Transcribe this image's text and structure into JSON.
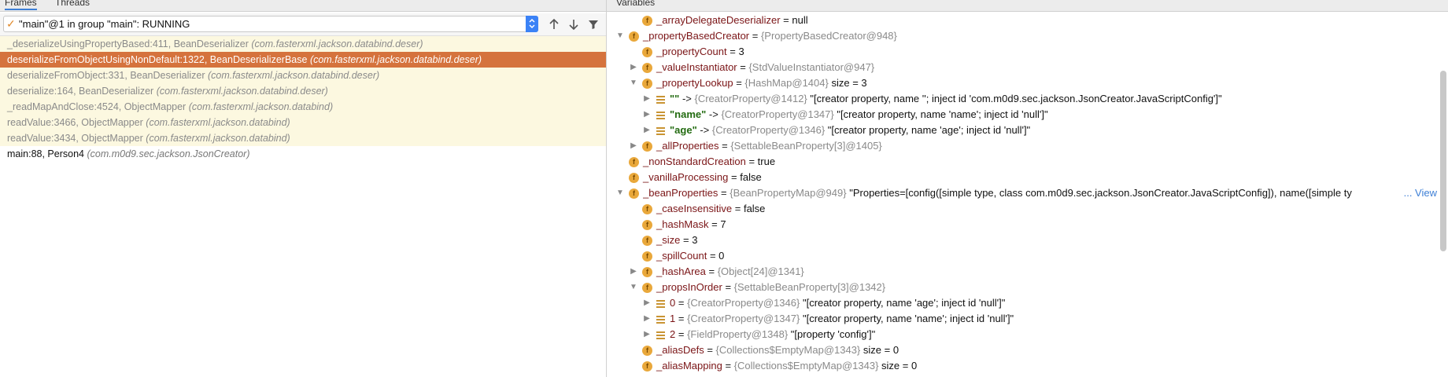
{
  "left_panel": {
    "tabs": [
      "Frames",
      "Threads"
    ],
    "thread_selector": "\"main\"@1 in group \"main\": RUNNING",
    "frames": [
      {
        "method": "_deserializeUsingPropertyBased:411, BeanDeserializer",
        "pkg": "(com.fasterxml.jackson.databind.deser)",
        "kind": "lib"
      },
      {
        "method": "deserializeFromObjectUsingNonDefault:1322, BeanDeserializerBase",
        "pkg": "(com.fasterxml.jackson.databind.deser)",
        "kind": "selected"
      },
      {
        "method": "deserializeFromObject:331, BeanDeserializer",
        "pkg": "(com.fasterxml.jackson.databind.deser)",
        "kind": "lib"
      },
      {
        "method": "deserialize:164, BeanDeserializer",
        "pkg": "(com.fasterxml.jackson.databind.deser)",
        "kind": "lib"
      },
      {
        "method": "_readMapAndClose:4524, ObjectMapper",
        "pkg": "(com.fasterxml.jackson.databind)",
        "kind": "lib"
      },
      {
        "method": "readValue:3466, ObjectMapper",
        "pkg": "(com.fasterxml.jackson.databind)",
        "kind": "lib"
      },
      {
        "method": "readValue:3434, ObjectMapper",
        "pkg": "(com.fasterxml.jackson.databind)",
        "kind": "lib"
      },
      {
        "method": "main:88, Person4",
        "pkg": "(com.m0d9.sec.jackson.JsonCreator)",
        "kind": "user"
      }
    ]
  },
  "right_panel": {
    "title": "Variables",
    "view_link": "... View",
    "rows": [
      {
        "level": 1,
        "arrow": "",
        "icon": "f",
        "name": "_arrayDelegateDeserializer",
        "eq": " = ",
        "type": "",
        "value": "null"
      },
      {
        "level": 0,
        "arrow": "down",
        "icon": "f",
        "name": "_propertyBasedCreator",
        "eq": " = ",
        "type": "{PropertyBasedCreator@948}",
        "value": ""
      },
      {
        "level": 1,
        "arrow": "",
        "icon": "f",
        "name": "_propertyCount",
        "eq": " = ",
        "type": "",
        "value": "3"
      },
      {
        "level": 1,
        "arrow": "right",
        "icon": "f",
        "name": "_valueInstantiator",
        "eq": " = ",
        "type": "{StdValueInstantiator@947}",
        "value": ""
      },
      {
        "level": 1,
        "arrow": "down",
        "icon": "f",
        "name": "_propertyLookup",
        "eq": " = ",
        "type": "{HashMap@1404}",
        "value": " size = 3"
      },
      {
        "level": 2,
        "arrow": "right",
        "icon": "list",
        "key": "\"\"",
        "eq": " -> ",
        "type": "{CreatorProperty@1412}",
        "value": "\"[creator property, name ''; inject id 'com.m0d9.sec.jackson.JsonCreator.JavaScriptConfig']\""
      },
      {
        "level": 2,
        "arrow": "right",
        "icon": "list",
        "key": "\"name\"",
        "eq": " -> ",
        "type": "{CreatorProperty@1347}",
        "value": "\"[creator property, name 'name'; inject id 'null']\""
      },
      {
        "level": 2,
        "arrow": "right",
        "icon": "list",
        "key": "\"age\"",
        "eq": " -> ",
        "type": "{CreatorProperty@1346}",
        "value": "\"[creator property, name 'age'; inject id 'null']\""
      },
      {
        "level": 1,
        "arrow": "right",
        "icon": "f",
        "name": "_allProperties",
        "eq": " = ",
        "type": "{SettableBeanProperty[3]@1405}",
        "value": ""
      },
      {
        "level": 0,
        "arrow": "",
        "icon": "f",
        "name": "_nonStandardCreation",
        "eq": " = ",
        "type": "",
        "value": "true"
      },
      {
        "level": 0,
        "arrow": "",
        "icon": "f",
        "name": "_vanillaProcessing",
        "eq": " = ",
        "type": "",
        "value": "false"
      },
      {
        "level": 0,
        "arrow": "down",
        "icon": "f",
        "name": "_beanProperties",
        "eq": " = ",
        "type": "{BeanPropertyMap@949}",
        "value": "\"Properties=[config([simple type, class com.m0d9.sec.jackson.JsonCreator.JavaScriptConfig]), name([simple ty",
        "view": true
      },
      {
        "level": 1,
        "arrow": "",
        "icon": "f",
        "name": "_caseInsensitive",
        "eq": " = ",
        "type": "",
        "value": "false"
      },
      {
        "level": 1,
        "arrow": "",
        "icon": "f",
        "name": "_hashMask",
        "eq": " = ",
        "type": "",
        "value": "7"
      },
      {
        "level": 1,
        "arrow": "",
        "icon": "f",
        "name": "_size",
        "eq": " = ",
        "type": "",
        "value": "3"
      },
      {
        "level": 1,
        "arrow": "",
        "icon": "f",
        "name": "_spillCount",
        "eq": " = ",
        "type": "",
        "value": "0"
      },
      {
        "level": 1,
        "arrow": "right",
        "icon": "f",
        "name": "_hashArea",
        "eq": " = ",
        "type": "{Object[24]@1341}",
        "value": ""
      },
      {
        "level": 1,
        "arrow": "down",
        "icon": "f",
        "name": "_propsInOrder",
        "eq": " = ",
        "type": "{SettableBeanProperty[3]@1342}",
        "value": ""
      },
      {
        "level": 2,
        "arrow": "right",
        "icon": "list",
        "name": "0",
        "eq": " = ",
        "type": "{CreatorProperty@1346}",
        "value": "\"[creator property, name 'age'; inject id 'null']\""
      },
      {
        "level": 2,
        "arrow": "right",
        "icon": "list",
        "name": "1",
        "eq": " = ",
        "type": "{CreatorProperty@1347}",
        "value": "\"[creator property, name 'name'; inject id 'null']\""
      },
      {
        "level": 2,
        "arrow": "right",
        "icon": "list",
        "name": "2",
        "eq": " = ",
        "type": "{FieldProperty@1348}",
        "value": "\"[property 'config']\""
      },
      {
        "level": 1,
        "arrow": "",
        "icon": "f",
        "name": "_aliasDefs",
        "eq": " = ",
        "type": "{Collections$EmptyMap@1343}",
        "value": " size = 0"
      },
      {
        "level": 1,
        "arrow": "",
        "icon": "f",
        "name": "_aliasMapping",
        "eq": " = ",
        "type": "{Collections$EmptyMap@1343}",
        "value": " size = 0"
      }
    ]
  }
}
